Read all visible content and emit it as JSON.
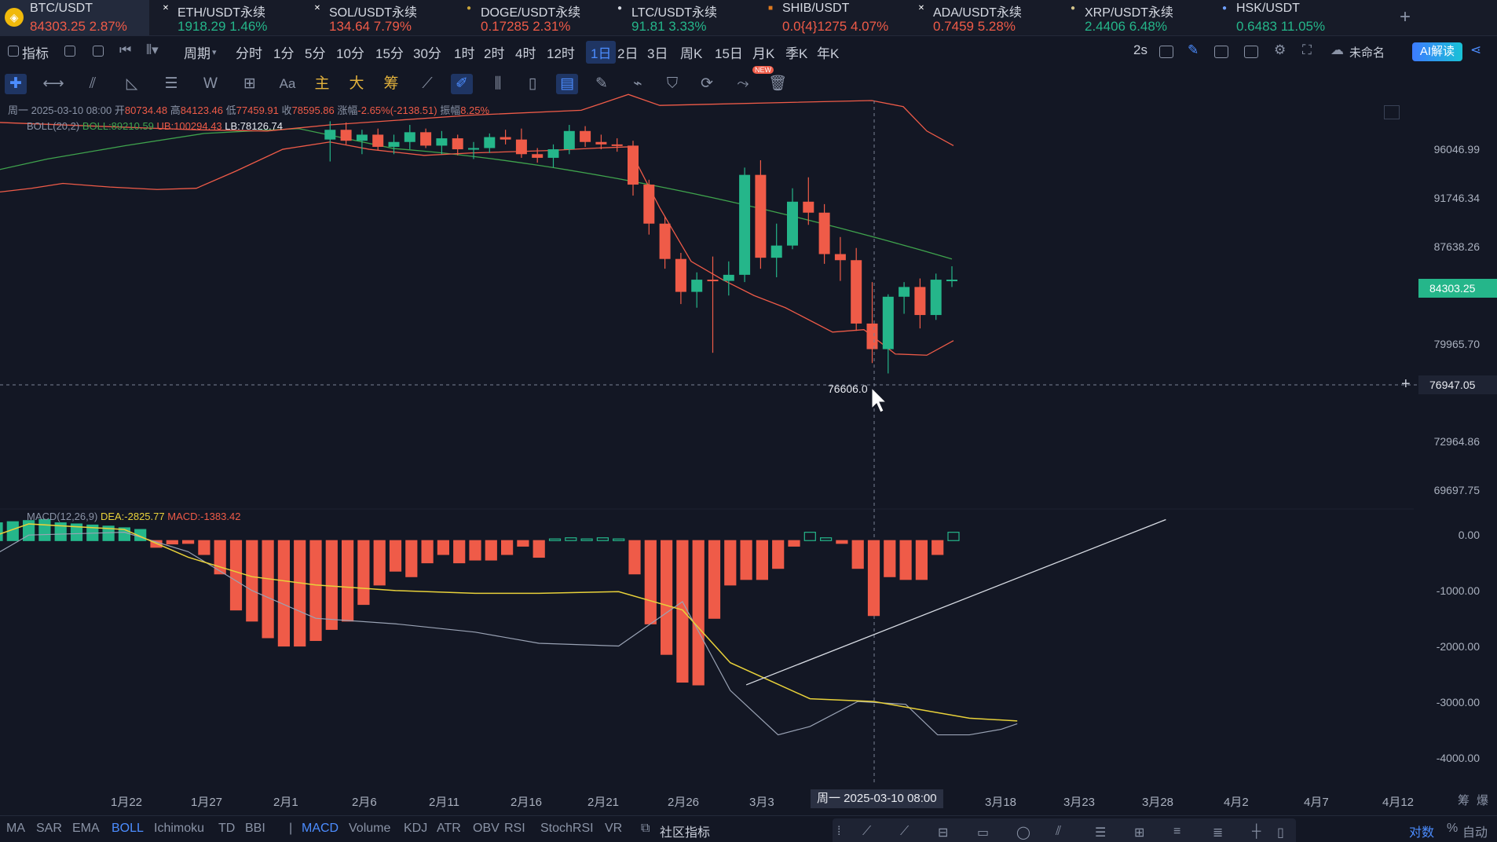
{
  "tickers": [
    {
      "symbol": "BTC/USDT",
      "price": "84303.25",
      "change": "2.87%",
      "dir": "down",
      "icon": "btc-icon",
      "glyph": "◈"
    },
    {
      "symbol": "ETH/USDT永续",
      "price": "1918.29",
      "change": "1.46%",
      "dir": "up",
      "icon": "x-icon",
      "glyph": "✕"
    },
    {
      "symbol": "SOL/USDT永续",
      "price": "134.64",
      "change": "7.79%",
      "dir": "down",
      "icon": "x-icon",
      "glyph": "✕"
    },
    {
      "symbol": "DOGE/USDT永续",
      "price": "0.17285",
      "change": "2.31%",
      "dir": "down",
      "icon": "doge-icon",
      "glyph": "●"
    },
    {
      "symbol": "LTC/USDT永续",
      "price": "91.81",
      "change": "3.33%",
      "dir": "up",
      "icon": "ltc-icon",
      "glyph": "●"
    },
    {
      "symbol": "SHIB/USDT",
      "price": "0.0{4}1275",
      "change": "4.07%",
      "dir": "down",
      "icon": "shib-icon",
      "glyph": "■"
    },
    {
      "symbol": "ADA/USDT永续",
      "price": "0.7459",
      "change": "5.28%",
      "dir": "down",
      "icon": "x-icon",
      "glyph": "✕"
    },
    {
      "symbol": "XRP/USDT永续",
      "price": "2.4406",
      "change": "6.48%",
      "dir": "up",
      "icon": "xrp-icon",
      "glyph": "●"
    },
    {
      "symbol": "HSK/USDT",
      "price": "0.6483",
      "change": "11.05%",
      "dir": "up",
      "icon": "hsk-icon",
      "glyph": "●"
    }
  ],
  "period_bar": {
    "indicator": "指标",
    "period": "周期",
    "items": [
      "分时",
      "1分",
      "5分",
      "10分",
      "15分",
      "30分",
      "1时",
      "2时",
      "4时",
      "12时",
      "1日",
      "2日",
      "3日",
      "周K",
      "15日",
      "月K",
      "季K",
      "年K"
    ],
    "selected": "1日",
    "refresh": "2s",
    "workspace": "未命名",
    "ai": "AI解读"
  },
  "draw_toolbar": {
    "text_tool": "Aa",
    "main": "主",
    "big": "大",
    "chips": "筹",
    "new_badge": "NEW"
  },
  "ohlc_legend": {
    "date": "周一 2025-03-10 08:00",
    "open_label": "开",
    "open": "80734.48",
    "high_label": "高",
    "high": "84123.46",
    "low_label": "低",
    "low": "77459.91",
    "close_label": "收",
    "close": "78595.86",
    "chg_label": "涨幅",
    "chg": "-2.65%(-2138.51)",
    "amp_label": "振幅",
    "amp": "8.25%"
  },
  "boll_legend": {
    "name": "BOLL(20,2)",
    "boll": "BOLL:89210.59",
    "ub": "UB:100294.43",
    "lb": "LB:78126.74"
  },
  "macd_legend": {
    "name": "MACD(12,26,9)",
    "dea": "DEA:-2825.77",
    "macd": "MACD:-1383.42"
  },
  "price_axis": [
    "96046.99",
    "91746.34",
    "87638.26",
    "79965.70",
    "72964.86",
    "69697.75"
  ],
  "current_price_tag": "84303.25",
  "crosshair_price_tag": "76947.05",
  "crosshair_low_label": "76606.0",
  "macd_axis": [
    "0.00",
    "-1000.00",
    "-2000.00",
    "-3000.00",
    "-4000.00"
  ],
  "date_axis": [
    "1月22",
    "1月27",
    "2月1",
    "2月6",
    "2月11",
    "2月16",
    "2月21",
    "2月26",
    "3月3",
    "3月18",
    "3月23",
    "3月28",
    "4月2",
    "4月7",
    "4月12"
  ],
  "crosshair_date": "周一 2025-03-10 08:00",
  "axis_corner": [
    "筹",
    "爆"
  ],
  "indicators_main": [
    "MA",
    "SAR",
    "EMA",
    "BOLL",
    "Ichimoku",
    "TD",
    "BBI"
  ],
  "indicators_sub": [
    "MACD",
    "Volume",
    "KDJ",
    "ATR",
    "OBV",
    "RSI",
    "StochRSI",
    "VR"
  ],
  "indicators_active": [
    "BOLL",
    "MACD"
  ],
  "community": "社区指标",
  "scale_options": [
    "对数",
    "%",
    "自动"
  ],
  "colors": {
    "up": "#25b68a",
    "down": "#ef5b48",
    "accent": "#4c8dff",
    "mid": "#3fa34d",
    "band": "#ef5b48",
    "dea": "#e8d13a",
    "dif": "#9aa3b5"
  },
  "chart_data": {
    "type": "candlestick",
    "interval": "1日",
    "price_range": [
      66000,
      99000
    ],
    "candles": [
      [
        95800,
        97300,
        94000,
        96600
      ],
      [
        96600,
        97200,
        95400,
        95700
      ],
      [
        95700,
        96600,
        94600,
        96200
      ],
      [
        96200,
        96700,
        94900,
        95200
      ],
      [
        95200,
        96200,
        94600,
        95600
      ],
      [
        95600,
        97000,
        95000,
        96400
      ],
      [
        96400,
        96700,
        95100,
        95300
      ],
      [
        95300,
        96500,
        94600,
        95900
      ],
      [
        95900,
        96200,
        94500,
        95000
      ],
      [
        95000,
        95600,
        94200,
        95100
      ],
      [
        95100,
        96300,
        94700,
        96000
      ],
      [
        96000,
        96600,
        95400,
        95800
      ],
      [
        95800,
        96700,
        94300,
        94600
      ],
      [
        94600,
        95100,
        93900,
        94300
      ],
      [
        94300,
        95400,
        93500,
        95000
      ],
      [
        95000,
        97000,
        94600,
        96500
      ],
      [
        96500,
        96900,
        95200,
        95600
      ],
      [
        95600,
        96200,
        95000,
        95400
      ],
      [
        95400,
        95900,
        94800,
        95300
      ],
      [
        95300,
        95700,
        91200,
        92100
      ],
      [
        92100,
        92500,
        88000,
        88900
      ],
      [
        88900,
        89500,
        85200,
        86000
      ],
      [
        86000,
        86500,
        82300,
        83300
      ],
      [
        83300,
        84900,
        82000,
        84300
      ],
      [
        84300,
        86200,
        78300,
        84200
      ],
      [
        84200,
        85800,
        83000,
        84700
      ],
      [
        84700,
        93500,
        84100,
        92900
      ],
      [
        92900,
        94100,
        85200,
        86100
      ],
      [
        86100,
        88900,
        84500,
        87100
      ],
      [
        87100,
        91800,
        86800,
        90700
      ],
      [
        90700,
        92700,
        88800,
        89800
      ],
      [
        89800,
        90500,
        85600,
        86400
      ],
      [
        86400,
        87800,
        84200,
        85900
      ],
      [
        85900,
        86900,
        80100,
        80700
      ],
      [
        80700,
        84100,
        77459,
        78600
      ],
      [
        78600,
        83100,
        76606,
        82900
      ],
      [
        82900,
        84100,
        81500,
        83700
      ],
      [
        83700,
        84400,
        80300,
        81400
      ],
      [
        81400,
        84800,
        81000,
        84300
      ],
      [
        84300,
        85400,
        83700,
        84303
      ]
    ],
    "boll": {
      "mid_start": 95300,
      "mid_end": 86000,
      "upper_recent": [
        98500,
        96500,
        95300
      ],
      "lower_recent": [
        80200,
        79200,
        78200,
        78100,
        79300
      ]
    },
    "macd": {
      "range": [
        -4200,
        400
      ],
      "hist": [
        300,
        320,
        340,
        360,
        380,
        320,
        300,
        280,
        260,
        230,
        200,
        -120,
        -60,
        -50,
        -250,
        -600,
        -1250,
        -1450,
        -1750,
        -1900,
        -1900,
        -1800,
        -1600,
        -1450,
        -1150,
        -800,
        -550,
        -650,
        -400,
        -250,
        -400,
        -350,
        -350,
        -250,
        -100,
        -300,
        30,
        50,
        30,
        50,
        30,
        -600,
        -1500,
        -2050,
        -2550,
        -2600,
        -1400,
        -800,
        -700,
        -700,
        -500,
        -100,
        150,
        50,
        -50,
        -500,
        -1350,
        -650,
        -700,
        -700,
        -250,
        150
      ],
      "dea_points": [
        [
          0,
          0
        ],
        [
          3,
          300
        ],
        [
          9,
          200
        ],
        [
          13,
          -300
        ],
        [
          17,
          -650
        ],
        [
          21,
          -800
        ],
        [
          26,
          -900
        ],
        [
          31,
          -950
        ],
        [
          35,
          -950
        ],
        [
          40,
          -920
        ],
        [
          44,
          -1250
        ],
        [
          47,
          -2200
        ],
        [
          52,
          -2850
        ],
        [
          56,
          -2900
        ],
        [
          58,
          -3000
        ],
        [
          62,
          -3200
        ],
        [
          65,
          -3250
        ]
      ],
      "dif_points": [
        [
          0,
          -400
        ],
        [
          3,
          100
        ],
        [
          9,
          150
        ],
        [
          13,
          -200
        ],
        [
          17,
          -900
        ],
        [
          21,
          -1400
        ],
        [
          26,
          -1500
        ],
        [
          31,
          -1650
        ],
        [
          35,
          -1850
        ],
        [
          40,
          -1900
        ],
        [
          44,
          -1100
        ],
        [
          47,
          -2700
        ],
        [
          50,
          -3500
        ],
        [
          52,
          -3350
        ],
        [
          55,
          -2900
        ],
        [
          58,
          -2950
        ],
        [
          60,
          -3500
        ],
        [
          62,
          -3500
        ],
        [
          64,
          -3400
        ],
        [
          65,
          -3300
        ]
      ],
      "trendline": [
        [
          -2600,
          48
        ],
        [
          -400,
          69
        ]
      ]
    },
    "crosshair": {
      "price": 76947.05,
      "date": "2025-03-10"
    }
  }
}
